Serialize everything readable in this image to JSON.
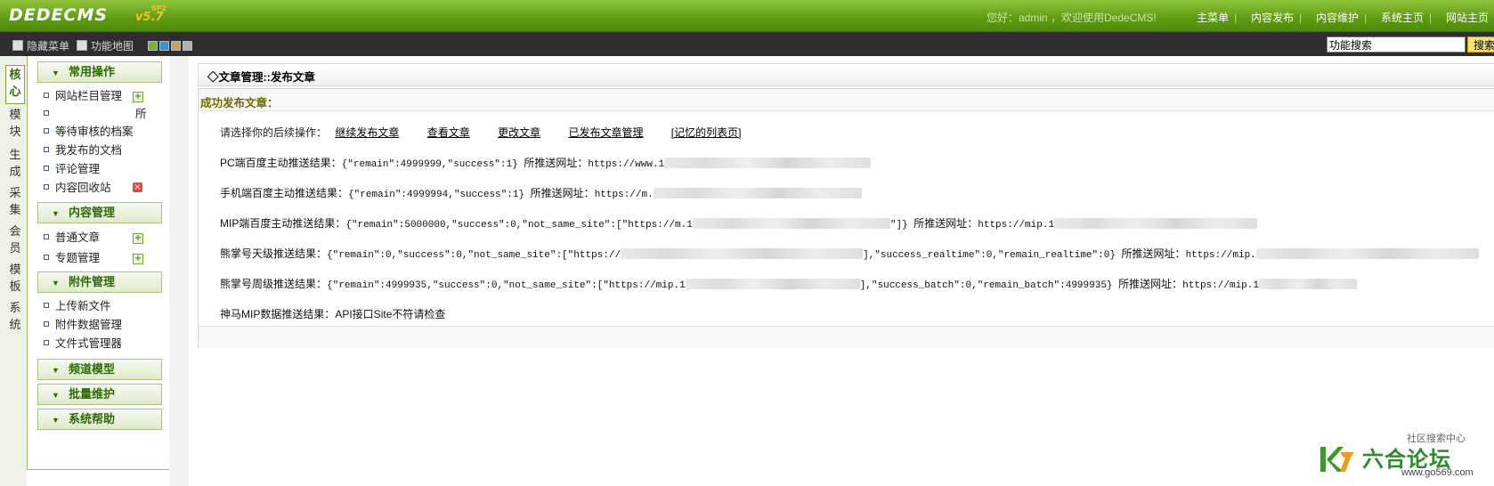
{
  "header": {
    "logo": "DEDECMS",
    "version": "v5.7",
    "version_sup": "SP2",
    "welcome": "您好：admin ，欢迎使用DedeCMS!",
    "nav": [
      "主菜单",
      "内容发布",
      "内容维护",
      "系统主页",
      "网站主页"
    ]
  },
  "toolbar": {
    "hide_menu": "隐藏菜单",
    "func_map": "功能地图",
    "skins": [
      "#7ab32a",
      "#3b8fd6",
      "#c8a060",
      "#b0b0b0"
    ],
    "search_value": "功能搜索",
    "search_button": "搜索"
  },
  "vtabs": [
    "核心",
    "模块",
    "生成",
    "采集",
    "会员",
    "模板",
    "系统"
  ],
  "menu": {
    "groups": [
      {
        "title": "常用操作",
        "items": [
          "网站栏目管理",
          "所",
          "等待审核的档案",
          "我发布的文档",
          "评论管理",
          "内容回收站"
        ]
      },
      {
        "title": "内容管理",
        "items": [
          "普通文章",
          "专题管理"
        ]
      },
      {
        "title": "附件管理",
        "items": [
          "上传新文件",
          "附件数据管理",
          "文件式管理器"
        ]
      },
      {
        "title": "频道模型",
        "items": []
      },
      {
        "title": "批量维护",
        "items": []
      },
      {
        "title": "系统帮助",
        "items": []
      }
    ]
  },
  "main": {
    "crumb": "◇文章管理::发布文章",
    "panel_title": "成功发布文章：",
    "choose_label": "请选择你的后续操作：",
    "actions": [
      "继续发布文章",
      "查看文章",
      "更改文章",
      "已发布文章管理",
      "[记忆的列表页]"
    ],
    "rows": [
      {
        "label": "PC端百度主动推送结果：",
        "result": "{\"remain\":4999999,\"success\":1}",
        "url_label": "所推送网址：",
        "url": "https://www.1"
      },
      {
        "label": "手机端百度主动推送结果：",
        "result": "{\"remain\":4999994,\"success\":1}",
        "url_label": "所推送网址：",
        "url": "https://m."
      },
      {
        "label": "MIP端百度主动推送结果：",
        "result_a": "{\"remain\":5000000,\"success\":0,\"not_same_site\":[\"https://m.1",
        "result_b": "\"]}",
        "url_label": "所推送网址：",
        "url": "https://mip.1"
      },
      {
        "label": "熊掌号天级推送结果：",
        "result_a": "{\"remain\":0,\"success\":0,\"not_same_site\":[\"https://",
        "result_b": "],\"success_realtime\":0,\"remain_realtime\":0}",
        "url_label": "所推送网址：",
        "url": "https://mip."
      },
      {
        "label": "熊掌号周级推送结果：",
        "result_a": "{\"remain\":4999935,\"success\":0,\"not_same_site\":[\"https://mip.1",
        "result_b": "],\"success_batch\":0,\"remain_batch\":4999935}",
        "url_label": "所推送网址：",
        "url": "https://mip.1"
      },
      {
        "label": "神马MIP数据推送结果：",
        "result": "API接口Site不符请检查"
      }
    ]
  },
  "watermark": {
    "top": "社区搜索中心",
    "title": "六合论坛",
    "url": "www.go569.com"
  }
}
